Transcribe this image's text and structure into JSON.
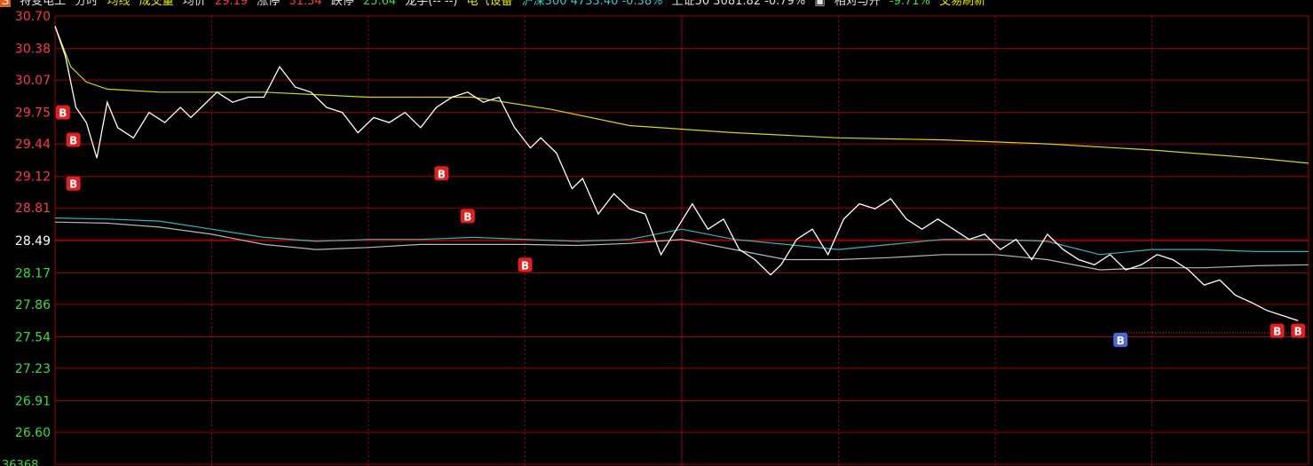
{
  "header": {
    "badge": "S",
    "stock_name": "特变电工",
    "mode": "分时",
    "line_label": "均线",
    "volume_label": "成交量",
    "avg_label": "均价",
    "avg_value": "29.19",
    "limit_up_label": "涨停",
    "limit_up_value": "31.34",
    "limit_down_label": "跌停",
    "limit_down_value": "25.64",
    "dragon_label": "龙手(-- --)",
    "sector": "电气设备",
    "index1": "沪深300 4733.40 -0.38%",
    "index2": "上证50 3081.82 -0.79%",
    "relative_label": "相对与开",
    "relative_value": "-9.71%",
    "refresh_label": "交易刷新"
  },
  "colors": {
    "background": "#000000",
    "grid": "#a00000",
    "price_line": "#ffffff",
    "avg_line": "#d8d800",
    "index_line_1": "#2fb8b8",
    "index_line_2": "#b8b8b8",
    "up_text": "#ff3b3b",
    "down_text": "#3bdc3b",
    "buy_marker": "#e02020",
    "sell_marker": "#4a6ad8"
  },
  "chart_data": {
    "type": "line",
    "title": "",
    "ylim": [
      26.6,
      30.7
    ],
    "reference_price": 28.49,
    "y_ticks": [
      "30.70",
      "30.38",
      "30.07",
      "29.75",
      "29.44",
      "29.12",
      "28.81",
      "28.49",
      "28.17",
      "27.86",
      "27.54",
      "27.23",
      "26.91",
      "26.60"
    ],
    "volume_axis_label": "36368",
    "grid": true,
    "x_range": [
      0,
      240
    ],
    "series": [
      {
        "key": "price",
        "color_key": "price_line",
        "points": [
          [
            0,
            30.6
          ],
          [
            2,
            30.3
          ],
          [
            4,
            29.8
          ],
          [
            6,
            29.65
          ],
          [
            8,
            29.3
          ],
          [
            10,
            29.85
          ],
          [
            12,
            29.6
          ],
          [
            15,
            29.5
          ],
          [
            18,
            29.75
          ],
          [
            21,
            29.65
          ],
          [
            24,
            29.8
          ],
          [
            26,
            29.7
          ],
          [
            28,
            29.8
          ],
          [
            31,
            29.95
          ],
          [
            34,
            29.85
          ],
          [
            37,
            29.9
          ],
          [
            40,
            29.9
          ],
          [
            43,
            30.2
          ],
          [
            46,
            30.0
          ],
          [
            49,
            29.95
          ],
          [
            52,
            29.8
          ],
          [
            55,
            29.75
          ],
          [
            58,
            29.55
          ],
          [
            61,
            29.7
          ],
          [
            64,
            29.65
          ],
          [
            67,
            29.75
          ],
          [
            70,
            29.6
          ],
          [
            73,
            29.8
          ],
          [
            76,
            29.9
          ],
          [
            79,
            29.95
          ],
          [
            82,
            29.85
          ],
          [
            85,
            29.9
          ],
          [
            88,
            29.6
          ],
          [
            91,
            29.4
          ],
          [
            93,
            29.5
          ],
          [
            96,
            29.35
          ],
          [
            99,
            29.0
          ],
          [
            101,
            29.1
          ],
          [
            104,
            28.75
          ],
          [
            107,
            28.95
          ],
          [
            110,
            28.8
          ],
          [
            113,
            28.75
          ],
          [
            116,
            28.35
          ],
          [
            119,
            28.6
          ],
          [
            122,
            28.85
          ],
          [
            125,
            28.6
          ],
          [
            128,
            28.7
          ],
          [
            131,
            28.4
          ],
          [
            134,
            28.3
          ],
          [
            137,
            28.15
          ],
          [
            139,
            28.25
          ],
          [
            142,
            28.5
          ],
          [
            145,
            28.6
          ],
          [
            148,
            28.35
          ],
          [
            151,
            28.7
          ],
          [
            154,
            28.85
          ],
          [
            157,
            28.8
          ],
          [
            160,
            28.9
          ],
          [
            163,
            28.7
          ],
          [
            166,
            28.6
          ],
          [
            169,
            28.7
          ],
          [
            172,
            28.6
          ],
          [
            175,
            28.5
          ],
          [
            178,
            28.55
          ],
          [
            181,
            28.4
          ],
          [
            184,
            28.5
          ],
          [
            187,
            28.3
          ],
          [
            190,
            28.55
          ],
          [
            193,
            28.4
          ],
          [
            196,
            28.3
          ],
          [
            199,
            28.25
          ],
          [
            202,
            28.35
          ],
          [
            205,
            28.2
          ],
          [
            208,
            28.25
          ],
          [
            211,
            28.35
          ],
          [
            214,
            28.3
          ],
          [
            217,
            28.2
          ],
          [
            220,
            28.05
          ],
          [
            223,
            28.1
          ],
          [
            226,
            27.95
          ],
          [
            229,
            27.88
          ],
          [
            232,
            27.8
          ],
          [
            235,
            27.75
          ],
          [
            238,
            27.7
          ]
        ]
      },
      {
        "key": "avg",
        "color_key": "avg_line",
        "points": [
          [
            0,
            30.6
          ],
          [
            3,
            30.2
          ],
          [
            6,
            30.05
          ],
          [
            10,
            29.98
          ],
          [
            20,
            29.95
          ],
          [
            40,
            29.95
          ],
          [
            60,
            29.9
          ],
          [
            80,
            29.9
          ],
          [
            95,
            29.78
          ],
          [
            110,
            29.62
          ],
          [
            130,
            29.55
          ],
          [
            150,
            29.5
          ],
          [
            170,
            29.48
          ],
          [
            190,
            29.44
          ],
          [
            210,
            29.38
          ],
          [
            230,
            29.3
          ],
          [
            240,
            29.25
          ]
        ]
      },
      {
        "key": "index1",
        "color_key": "index_line_1",
        "points": [
          [
            0,
            28.71
          ],
          [
            10,
            28.7
          ],
          [
            20,
            28.68
          ],
          [
            30,
            28.6
          ],
          [
            40,
            28.52
          ],
          [
            50,
            28.48
          ],
          [
            60,
            28.5
          ],
          [
            70,
            28.5
          ],
          [
            80,
            28.52
          ],
          [
            90,
            28.5
          ],
          [
            100,
            28.48
          ],
          [
            110,
            28.5
          ],
          [
            120,
            28.6
          ],
          [
            130,
            28.5
          ],
          [
            140,
            28.45
          ],
          [
            150,
            28.4
          ],
          [
            160,
            28.45
          ],
          [
            170,
            28.5
          ],
          [
            180,
            28.5
          ],
          [
            190,
            28.48
          ],
          [
            200,
            28.35
          ],
          [
            210,
            28.4
          ],
          [
            220,
            28.4
          ],
          [
            230,
            28.38
          ],
          [
            240,
            28.38
          ]
        ]
      },
      {
        "key": "index2",
        "color_key": "index_line_2",
        "points": [
          [
            0,
            28.67
          ],
          [
            10,
            28.66
          ],
          [
            20,
            28.62
          ],
          [
            30,
            28.55
          ],
          [
            40,
            28.45
          ],
          [
            50,
            28.4
          ],
          [
            60,
            28.42
          ],
          [
            70,
            28.45
          ],
          [
            80,
            28.45
          ],
          [
            90,
            28.45
          ],
          [
            100,
            28.44
          ],
          [
            110,
            28.46
          ],
          [
            120,
            28.5
          ],
          [
            130,
            28.4
          ],
          [
            140,
            28.3
          ],
          [
            150,
            28.3
          ],
          [
            160,
            28.32
          ],
          [
            170,
            28.35
          ],
          [
            180,
            28.35
          ],
          [
            190,
            28.3
          ],
          [
            200,
            28.2
          ],
          [
            210,
            28.22
          ],
          [
            220,
            28.22
          ],
          [
            230,
            28.24
          ],
          [
            240,
            28.25
          ]
        ]
      }
    ],
    "trade_markers": [
      {
        "label": "B",
        "kind": "buy",
        "x": 1.5,
        "y": 29.75
      },
      {
        "label": "B",
        "kind": "buy",
        "x": 3.5,
        "y": 29.48
      },
      {
        "label": "B",
        "kind": "buy",
        "x": 3.5,
        "y": 29.05
      },
      {
        "label": "B",
        "kind": "buy",
        "x": 74,
        "y": 29.15
      },
      {
        "label": "B",
        "kind": "buy",
        "x": 79,
        "y": 28.73
      },
      {
        "label": "B",
        "kind": "buy",
        "x": 90,
        "y": 28.25
      },
      {
        "label": "B",
        "kind": "sell",
        "x": 204,
        "y": 27.51
      },
      {
        "label": "B",
        "kind": "buy",
        "x": 234,
        "y": 27.6
      },
      {
        "label": "B",
        "kind": "buy",
        "x": 238,
        "y": 27.6
      }
    ]
  }
}
